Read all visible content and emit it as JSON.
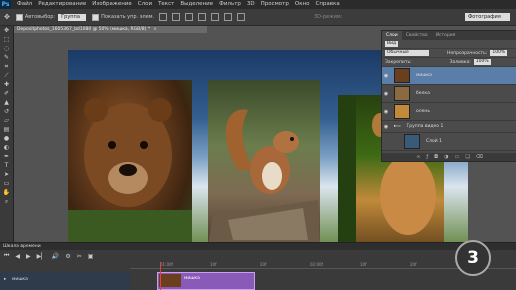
{
  "app": {
    "logo": "Ps"
  },
  "menu": {
    "items": [
      "Файл",
      "Редактирование",
      "Изображение",
      "Слои",
      "Текст",
      "Выделение",
      "Фильтр",
      "3D",
      "Просмотр",
      "Окно",
      "Справка"
    ]
  },
  "options_bar": {
    "autoselect_label": "Автовыбор:",
    "autoselect_value": "Группа",
    "show_controls_label": "Показать упр. элем.",
    "mode3d_label": "3D-режим:",
    "workspace_value": "Фотография"
  },
  "document": {
    "tab_title": "Depositphotos_1605367_bd1080 @ 50% (мишка, RGB/8) *",
    "close_glyph": "×"
  },
  "layers_panel": {
    "tabs": [
      "Слои",
      "Свойства",
      "История"
    ],
    "filter_label": "Вид",
    "blend_mode": "Обычные",
    "opacity_label": "Непрозрачность:",
    "opacity_value": "100%",
    "lock_label": "Закрепить:",
    "fill_label": "Заливка:",
    "fill_value": "100%",
    "layers": [
      {
        "name": "мишка",
        "selected": true
      },
      {
        "name": "белка",
        "selected": false
      },
      {
        "name": "олень",
        "selected": false
      },
      {
        "name": "Группа видео 1",
        "selected": false
      },
      {
        "name": "Слой 1",
        "selected": false
      }
    ],
    "footer_icons": [
      "link-icon",
      "fx-icon",
      "mask-icon",
      "adjustment-icon",
      "folder-icon",
      "new-layer-icon",
      "trash-icon"
    ]
  },
  "timeline": {
    "title": "Шкала времени",
    "track_name": "мишка",
    "clip_name": "мишка",
    "ruler_marks": [
      "01:00f",
      "10f",
      "20f",
      "02:00f",
      "10f",
      "20f",
      "03:00f"
    ]
  },
  "watermark": {
    "text": "3"
  }
}
